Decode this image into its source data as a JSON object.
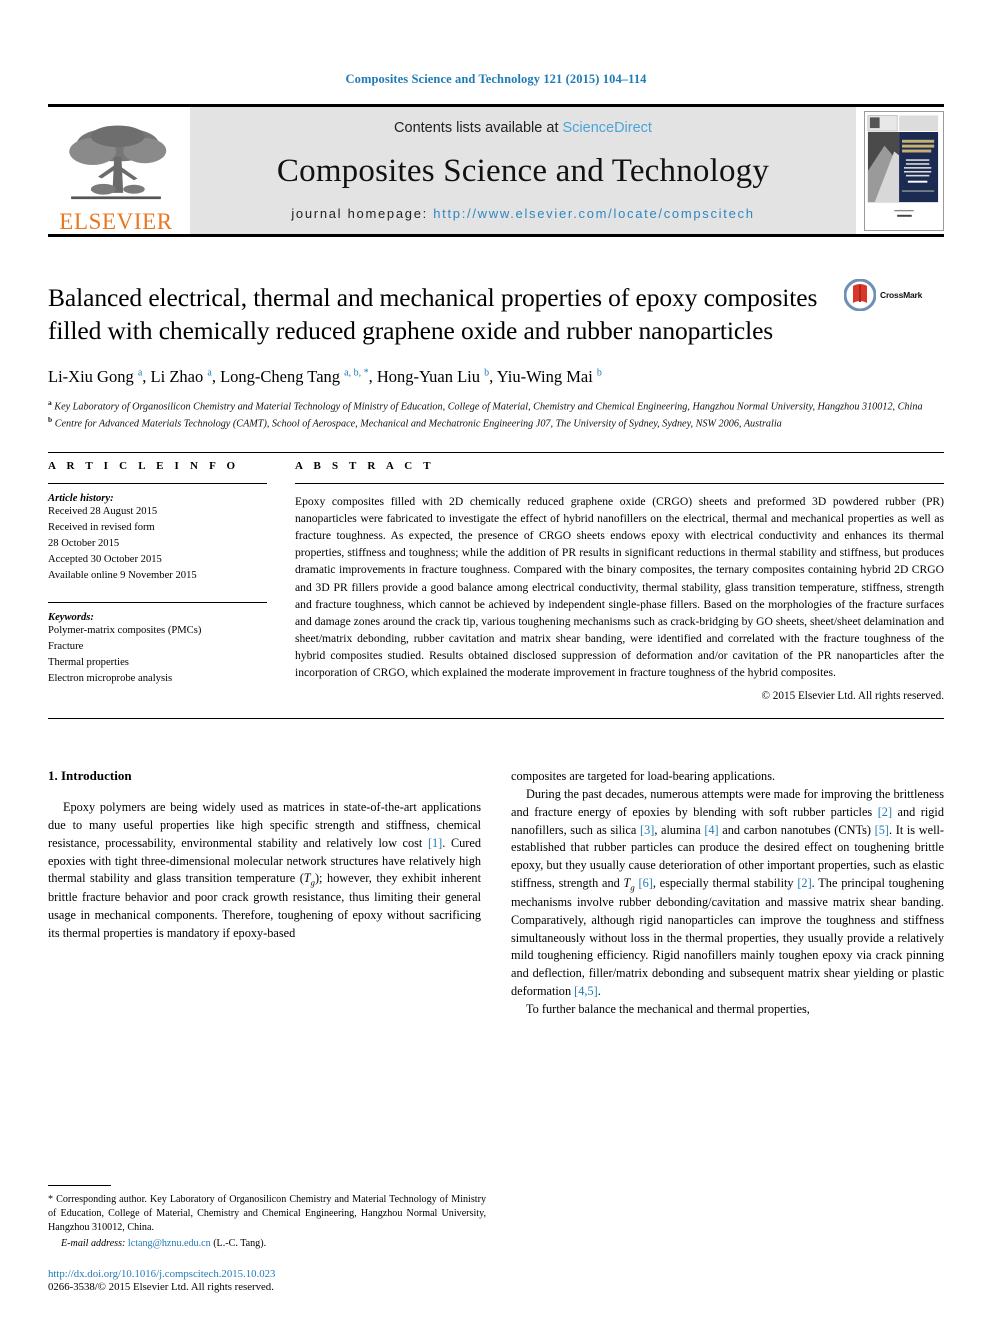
{
  "running_head": "Composites Science and Technology 121 (2015) 104–114",
  "masthead": {
    "publisher_name": "ELSEVIER",
    "contents_prefix": "Contents lists available at ",
    "contents_link": "ScienceDirect",
    "journal_title": "Composites Science and Technology",
    "homepage_prefix": "journal homepage: ",
    "homepage_url": "http://www.elsevier.com/locate/compscitech",
    "cover_title_line1": "COMPOSITES",
    "cover_title_line2": "SCIENCE AND",
    "cover_title_line3": "TECHNOLOGY"
  },
  "article": {
    "title": "Balanced electrical, thermal and mechanical properties of epoxy composites filled with chemically reduced graphene oxide and rubber nanoparticles",
    "crossmark_label": "CrossMark",
    "authors_html": "Li-Xiu Gong <sup>a</sup>, Li Zhao <sup>a</sup>, Long-Cheng Tang <sup>a, b, *</sup>, Hong-Yuan Liu <sup>b</sup>, Yiu-Wing Mai <sup>b</sup>",
    "affiliation_a": "Key Laboratory of Organosilicon Chemistry and Material Technology of Ministry of Education, College of Material, Chemistry and Chemical Engineering, Hangzhou Normal University, Hangzhou 310012, China",
    "affiliation_b": "Centre for Advanced Materials Technology (CAMT), School of Aerospace, Mechanical and Mechatronic Engineering J07, The University of Sydney, Sydney, NSW 2006, Australia"
  },
  "article_info": {
    "heading": "A R T I C L E   I N F O",
    "history_label": "Article history:",
    "history": [
      "Received 28 August 2015",
      "Received in revised form",
      "28 October 2015",
      "Accepted 30 October 2015",
      "Available online 9 November 2015"
    ],
    "keywords_label": "Keywords:",
    "keywords": [
      "Polymer-matrix composites (PMCs)",
      "Fracture",
      "Thermal properties",
      "Electron microprobe analysis"
    ]
  },
  "abstract": {
    "heading": "A B S T R A C T",
    "text": "Epoxy composites filled with 2D chemically reduced graphene oxide (CRGO) sheets and preformed 3D powdered rubber (PR) nanoparticles were fabricated to investigate the effect of hybrid nanofillers on the electrical, thermal and mechanical properties as well as fracture toughness. As expected, the presence of CRGO sheets endows epoxy with electrical conductivity and enhances its thermal properties, stiffness and toughness; while the addition of PR results in significant reductions in thermal stability and stiffness, but produces dramatic improvements in fracture toughness. Compared with the binary composites, the ternary composites containing hybrid 2D CRGO and 3D PR fillers provide a good balance among electrical conductivity, thermal stability, glass transition temperature, stiffness, strength and fracture toughness, which cannot be achieved by independent single-phase fillers. Based on the morphologies of the fracture surfaces and damage zones around the crack tip, various toughening mechanisms such as crack-bridging by GO sheets, sheet/sheet delamination and sheet/matrix debonding, rubber cavitation and matrix shear banding, were identified and correlated with the fracture toughness of the hybrid composites studied. Results obtained disclosed suppression of deformation and/or cavitation of the PR nanoparticles after the incorporation of CRGO, which explained the moderate improvement in fracture toughness of the hybrid composites.",
    "copyright": "© 2015 Elsevier Ltd. All rights reserved."
  },
  "body": {
    "section_title": "1. Introduction",
    "left_paragraphs": [
      "Epoxy polymers are being widely used as matrices in state-of-the-art applications due to many useful properties like high specific strength and stiffness, chemical resistance, processability, environmental stability and relatively low cost [1]. Cured epoxies with tight three-dimensional molecular network structures have relatively high thermal stability and glass transition temperature (Tg); however, they exhibit inherent brittle fracture behavior and poor crack growth resistance, thus limiting their general usage in mechanical components. Therefore, toughening of epoxy without sacrificing its thermal properties is mandatory if epoxy-based"
    ],
    "right_paragraphs": [
      "composites are targeted for load-bearing applications.",
      "During the past decades, numerous attempts were made for improving the brittleness and fracture energy of epoxies by blending with soft rubber particles [2] and rigid nanofillers, such as silica [3], alumina [4] and carbon nanotubes (CNTs) [5]. It is well-established that rubber particles can produce the desired effect on toughening brittle epoxy, but they usually cause deterioration of other important properties, such as elastic stiffness, strength and Tg [6], especially thermal stability [2]. The principal toughening mechanisms involve rubber debonding/cavitation and massive matrix shear banding. Comparatively, although rigid nanoparticles can improve the toughness and stiffness simultaneously without loss in the thermal properties, they usually provide a relatively mild toughening efficiency. Rigid nanofillers mainly toughen epoxy via crack pinning and deflection, filler/matrix debonding and subsequent matrix shear yielding or plastic deformation [4,5].",
      "To further balance the mechanical and thermal properties,"
    ]
  },
  "footnote": {
    "corresponding": "* Corresponding author. Key Laboratory of Organosilicon Chemistry and Material Technology of Ministry of Education, College of Material, Chemistry and Chemical Engineering, Hangzhou Normal University, Hangzhou 310012, China.",
    "email_label": "E-mail address:",
    "email": "lctang@hznu.edu.cn",
    "email_suffix": "(L.-C. Tang).",
    "doi": "http://dx.doi.org/10.1016/j.compscitech.2015.10.023",
    "issn": "0266-3538/© 2015 Elsevier Ltd. All rights reserved."
  },
  "colors": {
    "link_blue": "#1f7bb6",
    "sciencedirect_blue": "#4ca3d8",
    "elsevier_orange": "#E87722",
    "masthead_gray": "#e3e3e3"
  }
}
